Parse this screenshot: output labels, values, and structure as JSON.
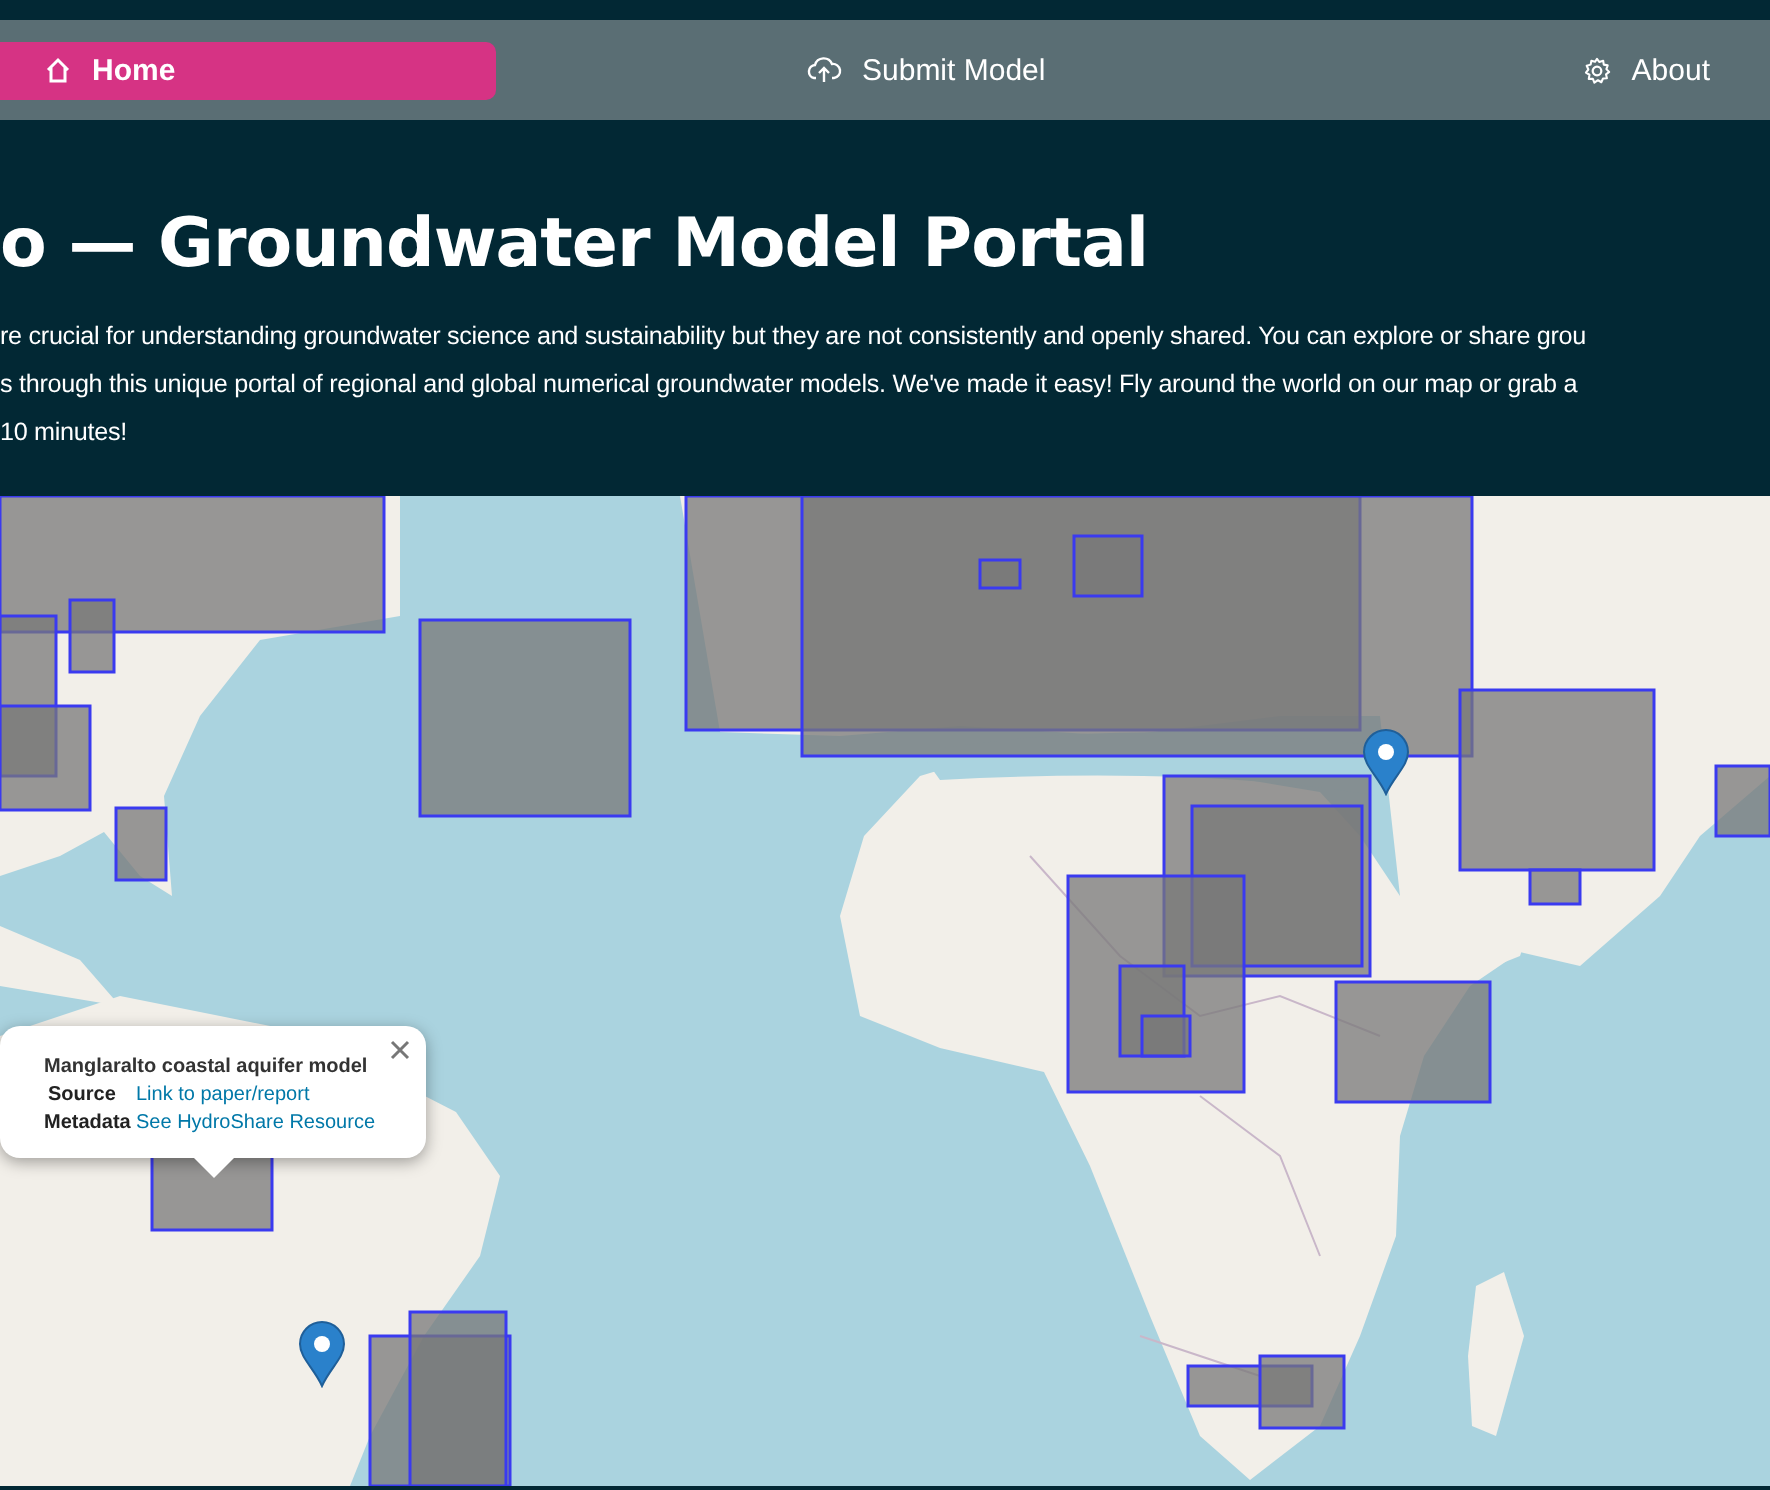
{
  "nav": [
    {
      "label": "Home",
      "selected": true
    },
    {
      "label": "Submit Model",
      "selected": false
    },
    {
      "label": "About",
      "selected": false
    }
  ],
  "header": {
    "title": "o — Groundwater Model Portal",
    "intro_lines": [
      "re crucial for understanding groundwater science and sustainability but they are not consistently and openly shared. You can explore or share grou",
      "s through this unique portal of regional and global numerical groundwater models. We've made it easy! Fly around the world on our map or grab a",
      "10 minutes!"
    ]
  },
  "map": {
    "markers": [
      {
        "kind": "pin"
      },
      {
        "kind": "pin"
      }
    ],
    "popup": {
      "title": "Manglaralto coastal aquifer model",
      "rows": [
        {
          "label": "Source",
          "link": "Link to paper/report"
        },
        {
          "label": "Metadata",
          "link": "See HydroShare Resource"
        }
      ]
    }
  }
}
